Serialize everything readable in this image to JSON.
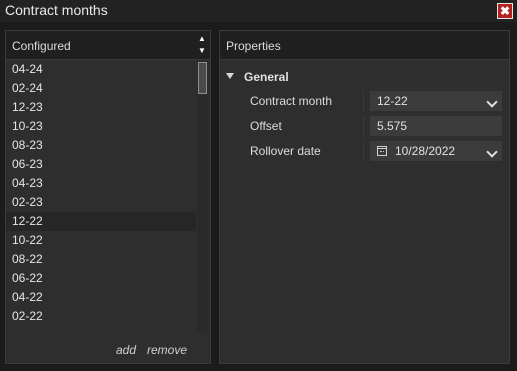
{
  "window": {
    "title": "Contract months",
    "close_glyph": "✖"
  },
  "configured": {
    "header": "Configured",
    "sort_up": "▲",
    "sort_down": "▼",
    "items": [
      "04-24",
      "02-24",
      "12-23",
      "10-23",
      "08-23",
      "06-23",
      "04-23",
      "02-23",
      "12-22",
      "10-22",
      "08-22",
      "06-22",
      "04-22",
      "02-22"
    ],
    "selected": "12-22",
    "add_label": "add",
    "remove_label": "remove"
  },
  "properties": {
    "header": "Properties",
    "group": "General",
    "contract_month": {
      "label": "Contract month",
      "value": "12-22"
    },
    "offset": {
      "label": "Offset",
      "value": "5.575"
    },
    "rollover_date": {
      "label": "Rollover date",
      "value": "10/28/2022"
    }
  },
  "icons": [
    "close-icon",
    "sort-up-icon",
    "sort-down-icon",
    "expand-arrow-icon",
    "chevron-down-icon",
    "calendar-icon"
  ]
}
